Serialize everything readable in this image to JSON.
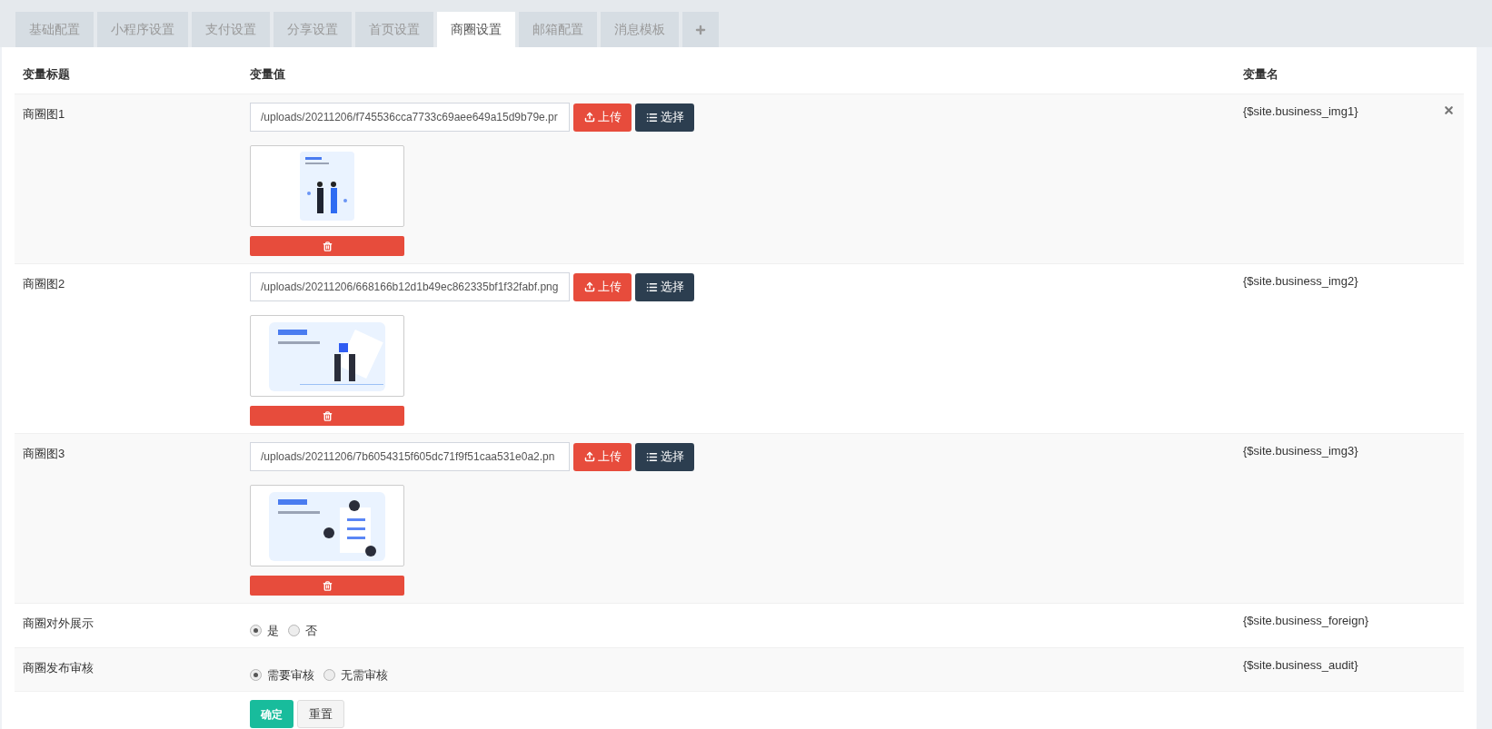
{
  "tabs": [
    {
      "label": "基础配置",
      "selected": false
    },
    {
      "label": "小程序设置",
      "selected": false
    },
    {
      "label": "支付设置",
      "selected": false
    },
    {
      "label": "分享设置",
      "selected": false
    },
    {
      "label": "首页设置",
      "selected": false
    },
    {
      "label": "商圈设置",
      "selected": true
    },
    {
      "label": "邮箱配置",
      "selected": false
    },
    {
      "label": "消息模板",
      "selected": false
    }
  ],
  "table": {
    "columns": [
      "变量标题",
      "变量值",
      "变量名"
    ],
    "rows": [
      {
        "title": "商圈图1",
        "value": "/uploads/20211206/f745536cca7733c69aee649a15d9b79e.pr",
        "upload_label": "上传",
        "select_label": "选择",
        "variable": "{$site.business_img1}",
        "removable": true
      },
      {
        "title": "商圈图2",
        "value": "/uploads/20211206/668166b12d1b49ec862335bf1f32fabf.png",
        "upload_label": "上传",
        "select_label": "选择",
        "variable": "{$site.business_img2}",
        "removable": false
      },
      {
        "title": "商圈图3",
        "value": "/uploads/20211206/7b6054315f605dc71f9f51caa531e0a2.pn",
        "upload_label": "上传",
        "select_label": "选择",
        "variable": "{$site.business_img3}",
        "removable": false
      },
      {
        "kind": "radio",
        "title": "商圈对外展示",
        "options": [
          {
            "label": "是",
            "selected": true
          },
          {
            "label": "否",
            "selected": false
          }
        ],
        "variable": "{$site.business_foreign}",
        "removable": false
      },
      {
        "kind": "radio",
        "title": "商圈发布审核",
        "options": [
          {
            "label": "需要审核",
            "selected": true
          },
          {
            "label": "无需审核",
            "selected": false
          }
        ],
        "variable": "{$site.business_audit}",
        "removable": false
      }
    ]
  },
  "buttons": [
    {
      "label": "确定",
      "kind": "primary"
    },
    {
      "label": "重置",
      "kind": "default"
    }
  ]
}
